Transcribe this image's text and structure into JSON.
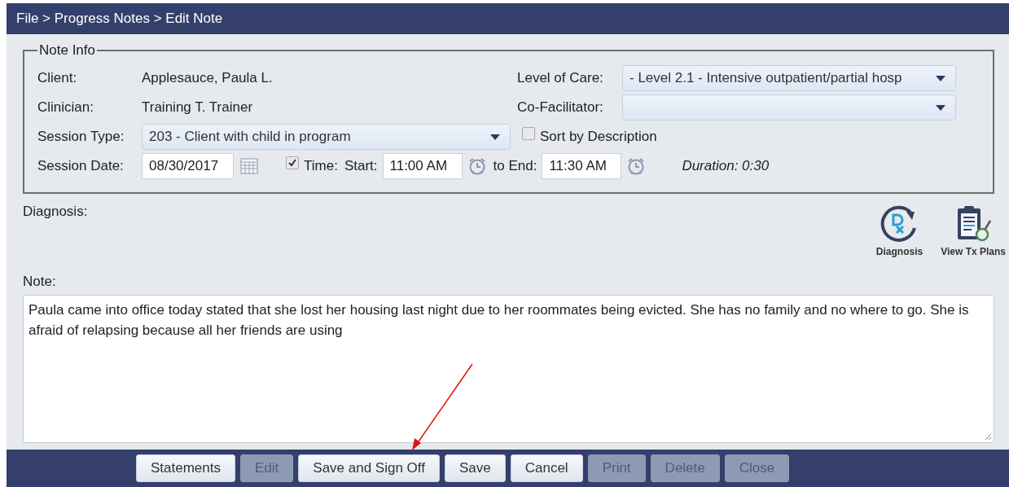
{
  "breadcrumb": "File > Progress Notes > Edit Note",
  "note_info": {
    "title": "Note Info",
    "client": {
      "label": "Client:",
      "value": "Applesauce, Paula L."
    },
    "clinician": {
      "label": "Clinician:",
      "value": "Training T. Trainer"
    },
    "level_of_care": {
      "label": "Level of Care:",
      "value": "- Level 2.1 - Intensive outpatient/partial hosp"
    },
    "co_facilitator": {
      "label": "Co-Facilitator:"
    },
    "session_type": {
      "label": "Session Type:",
      "value": "203 - Client with child in program"
    },
    "sort_by_description": {
      "label": "Sort by Description",
      "checked": false
    },
    "session_date": {
      "label": "Session Date:",
      "value": "08/30/2017"
    },
    "time": {
      "label": "Time:",
      "checked": true
    },
    "start": {
      "label": "Start:",
      "value": "11:00 AM"
    },
    "end": {
      "label": "to End:",
      "value": "11:30 AM"
    },
    "duration": "Duration: 0:30"
  },
  "diagnosis_label": "Diagnosis:",
  "tools": [
    {
      "label": "Diagnosis",
      "kind": "dx"
    },
    {
      "label": "View Tx Plans",
      "kind": "clipboard"
    }
  ],
  "note": {
    "label": "Note:",
    "value": "Paula came into office today stated that she lost her housing last night due to her roommates being evicted. She has no family and no where to go. She is afraid of relapsing because all her friends are using"
  },
  "buttons": [
    {
      "label": "Statements",
      "disabled": false
    },
    {
      "label": "Edit",
      "disabled": true
    },
    {
      "label": "Save and Sign Off",
      "disabled": false
    },
    {
      "label": "Save",
      "disabled": false
    },
    {
      "label": "Cancel",
      "disabled": false
    },
    {
      "label": "Print",
      "disabled": true
    },
    {
      "label": "Delete",
      "disabled": true
    },
    {
      "label": "Close",
      "disabled": true
    }
  ]
}
